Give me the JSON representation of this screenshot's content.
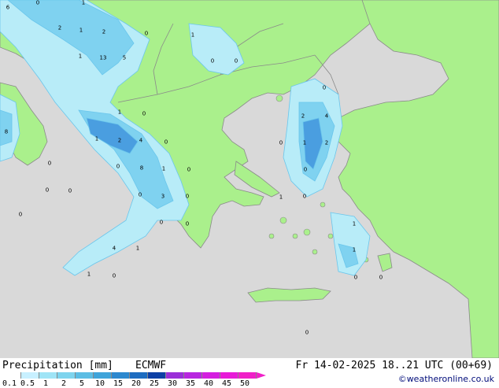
{
  "legend": {
    "title": "Precipitation [mm]",
    "model": "ECMWF",
    "datetime": "Fr 14-02-2025 18..21 UTC (00+69)",
    "credit": "©weatheronline.co.uk",
    "ticks": [
      "0.1",
      "0.5",
      "1",
      "2",
      "5",
      "10",
      "15",
      "20",
      "25",
      "30",
      "35",
      "40",
      "45",
      "50"
    ],
    "colors": [
      "#ffffff",
      "#c8f0ff",
      "#9fe4f6",
      "#7ed4ee",
      "#5cbde4",
      "#3fa4da",
      "#2c88cf",
      "#1d6cc0",
      "#0d3fa5",
      "#9a2fd8",
      "#b826e0",
      "#d41ee0",
      "#e81ad8",
      "#f020c8"
    ]
  },
  "map_colors": {
    "sea": "#d9d9d9",
    "land": "#aaf08c",
    "border": "#8a8a8a",
    "precip_light": "#b8ecf8",
    "precip_mid": "#7fd2f0",
    "precip_heavy": "#4a9ee0"
  },
  "labels": [
    "0",
    "1",
    "6",
    "2",
    "1",
    "2",
    "0",
    "1",
    "13",
    "5",
    "0",
    "0",
    "1",
    "8",
    "0",
    "1",
    "2",
    "0",
    "4",
    "0",
    "1",
    "2",
    "1",
    "2",
    "4",
    "0",
    "0",
    "0",
    "8",
    "0",
    "1",
    "0",
    "0",
    "0",
    "0",
    "0",
    "1",
    "3",
    "0",
    "0",
    "0",
    "0",
    "1",
    "4",
    "1",
    "1",
    "1",
    "0",
    "0",
    "0",
    "0"
  ]
}
